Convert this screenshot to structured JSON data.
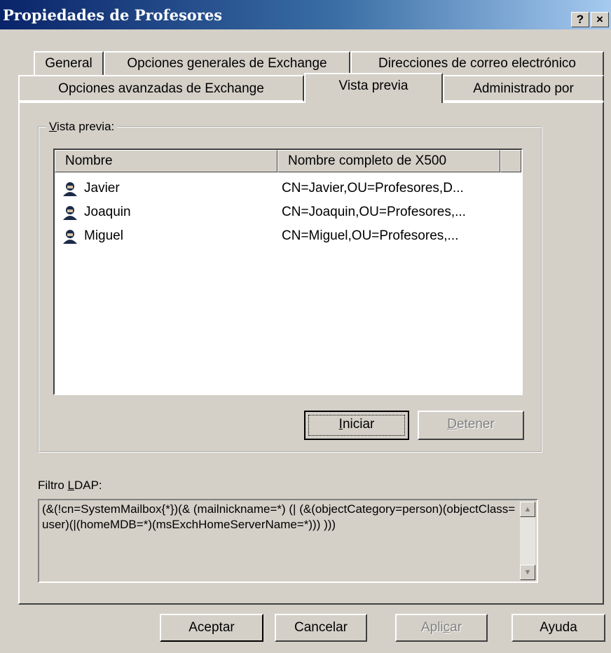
{
  "window": {
    "title": "Propiedades de Profesores",
    "help_glyph": "?",
    "close_glyph": "×"
  },
  "tabs": {
    "row1": [
      "General",
      "Opciones generales de Exchange",
      "Direcciones de correo electrónico"
    ],
    "row2": [
      "Opciones avanzadas de Exchange",
      "Vista previa",
      "Administrado por"
    ],
    "active": "Vista previa"
  },
  "preview": {
    "group_label_prefix": "",
    "group_label_accel": "V",
    "group_label_rest": "ista previa:",
    "columns": [
      "Nombre",
      "Nombre completo de X500"
    ],
    "rows": [
      {
        "name": "Javier",
        "x500": "CN=Javier,OU=Profesores,D..."
      },
      {
        "name": "Joaquin",
        "x500": "CN=Joaquin,OU=Profesores,..."
      },
      {
        "name": "Miguel",
        "x500": "CN=Miguel,OU=Profesores,..."
      }
    ],
    "start_accel": "I",
    "start_rest": "niciar",
    "stop_accel": "D",
    "stop_rest": "etener"
  },
  "ldap": {
    "label_prefix": "Filtro ",
    "label_accel": "L",
    "label_rest": "DAP:",
    "filter": "(&(!cn=SystemMailbox{*})(& (mailnickname=*) (| (&(objectCategory=person)(objectClass=user)(|(homeMDB=*)(msExchHomeServerName=*))) )))"
  },
  "buttons": {
    "ok": "Aceptar",
    "cancel": "Cancelar",
    "apply_prefix": "Apli",
    "apply_accel": "c",
    "apply_rest": "ar",
    "help": "Ayuda"
  }
}
